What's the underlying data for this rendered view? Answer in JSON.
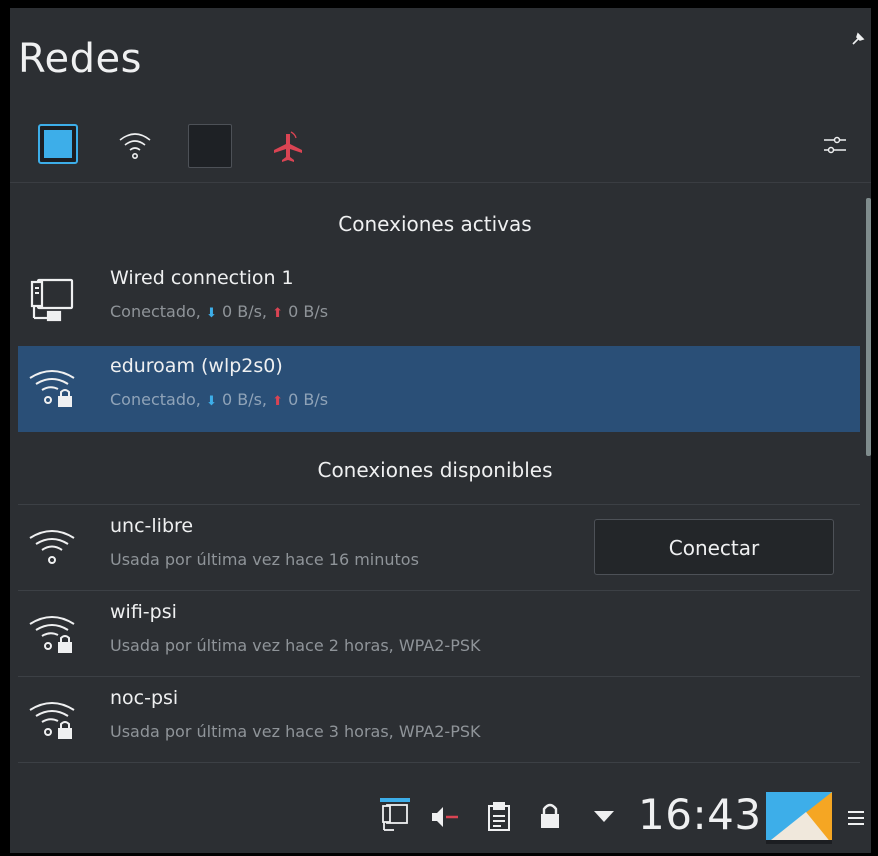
{
  "applet": {
    "title": "Redes"
  },
  "toolbar": {
    "ethernet_toggle": "network-wired-icon",
    "wifi_toggle": "wifi-icon",
    "mobile_toggle": "mobile-broadband-icon",
    "airplane_toggle": "airplane-mode-icon",
    "config": "configure-icon"
  },
  "sections": {
    "active": "Conexiones activas",
    "available": "Conexiones disponibles"
  },
  "active_connections": [
    {
      "name": "Wired connection 1",
      "status": "Conectado,",
      "down_rate": "0 B/s,",
      "up_rate": "0 B/s",
      "icon": "wired-connection-icon",
      "selected": false
    },
    {
      "name": "eduroam (wlp2s0)",
      "status": "Conectado,",
      "down_rate": "0 B/s,",
      "up_rate": "0 B/s",
      "icon": "wifi-secure-icon",
      "selected": true
    }
  ],
  "available_connections": [
    {
      "name": "unc-libre",
      "detail": "Usada por última vez hace 16 minutos",
      "icon": "wifi-open-icon"
    },
    {
      "name": "wifi-psi",
      "detail": "Usada por última vez hace 2 horas, WPA2-PSK",
      "icon": "wifi-secure-icon"
    },
    {
      "name": "noc-psi",
      "detail": "Usada por última vez hace 3 horas, WPA2-PSK",
      "icon": "wifi-secure-icon"
    }
  ],
  "connect_button": {
    "label": "Conectar"
  },
  "taskbar": {
    "clock": "16:43"
  },
  "colors": {
    "accent": "#3daee9",
    "selection": "#2a4f77",
    "airplane": "#da4453",
    "background": "#2c2f33"
  }
}
